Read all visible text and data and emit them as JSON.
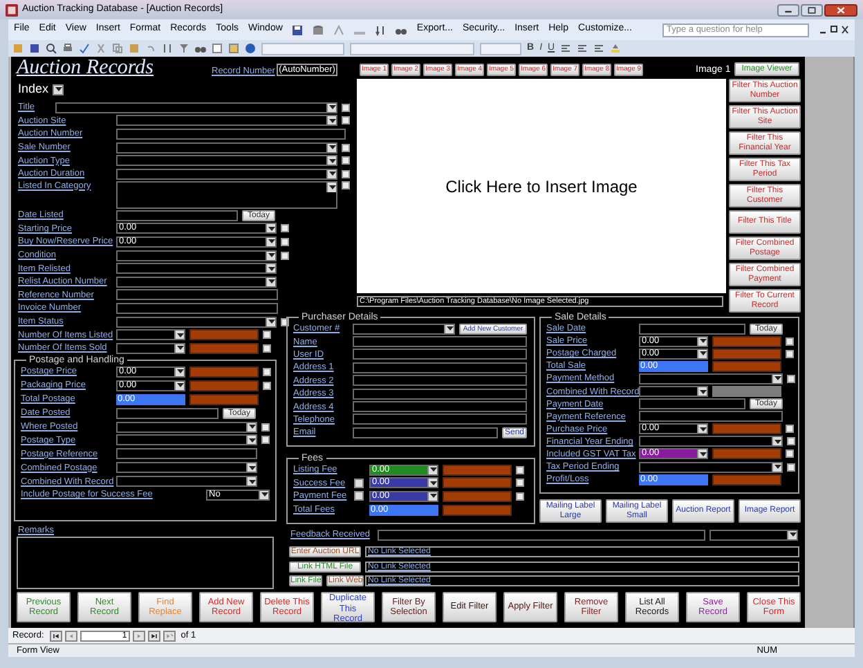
{
  "window": {
    "title": "Auction Tracking Database - [Auction Records]"
  },
  "menu": [
    "File",
    "Edit",
    "View",
    "Insert",
    "Format",
    "Records",
    "Tools",
    "Window"
  ],
  "menu_right": [
    "Export...",
    "Security...",
    "Insert",
    "Help",
    "Customize..."
  ],
  "help": {
    "placeholder": "Type a question for help"
  },
  "format_buttons": [
    "B",
    "I",
    "U"
  ],
  "form": {
    "heading": "Auction Records",
    "record_number": {
      "label": "Record Number",
      "value": "(AutoNumber)"
    },
    "image_tabs": [
      "Image 1",
      "Image 2",
      "Image 3",
      "Image 4",
      "Image 5",
      "Image 6",
      "Image 7",
      "Image 8",
      "Image 9"
    ],
    "image_label": "Image 1",
    "image_viewer": "Image Viewer",
    "image_prompt": "Click Here to Insert Image",
    "image_path": "C:\\Program Files\\Auction Tracking Database\\No Image Selected.jpg",
    "filters": [
      "Filter This Auction Number",
      "Filter This Auction Site",
      "Filter This Financial Year",
      "Filter This Tax Period",
      "Filter This Customer",
      "Filter This Title",
      "Filter Combined Postage",
      "Filter Combined Payment",
      "Filter To Current Record"
    ],
    "index": "Index",
    "fields": [
      {
        "label": "Title",
        "kind": "wide_combo_check"
      },
      {
        "label": "Auction Site",
        "kind": "combo_check"
      },
      {
        "label": "Auction Number",
        "kind": "text"
      },
      {
        "label": "Sale Number",
        "kind": "combo_check"
      },
      {
        "label": "Auction Type",
        "kind": "combo_check"
      },
      {
        "label": "Auction Duration",
        "kind": "combo_check"
      },
      {
        "label": "Listed In Category",
        "kind": "memo_check"
      }
    ],
    "fields_2": [
      {
        "label": "Date Listed",
        "kind": "date",
        "button": "Today"
      },
      {
        "label": "Starting Price",
        "kind": "combo_check",
        "value": "0.00"
      },
      {
        "label": "Buy Now/Reserve Price",
        "kind": "combo_check",
        "value": "0.00"
      },
      {
        "label": "Condition",
        "kind": "combo_check"
      },
      {
        "label": "Item Relisted",
        "kind": "combo"
      },
      {
        "label": "Relist Auction Number",
        "kind": "combo"
      },
      {
        "label": "Reference Number",
        "kind": "text"
      },
      {
        "label": "Invoice Number",
        "kind": "text"
      },
      {
        "label": "Item Status",
        "kind": "combo_check"
      },
      {
        "label": "Number Of Items Listed",
        "kind": "split_check"
      },
      {
        "label": "Number Of Items Sold",
        "kind": "split_check"
      }
    ],
    "postage": {
      "title": "Postage and Handling",
      "fields": [
        {
          "label": "Postage Price",
          "kind": "split_check",
          "value": "0.00"
        },
        {
          "label": "Packaging Price",
          "kind": "split_check",
          "value": "0.00"
        },
        {
          "label": "Total Postage",
          "kind": "calc",
          "value": "0.00"
        },
        {
          "label": "Date Posted",
          "kind": "date",
          "button": "Today"
        },
        {
          "label": "Where Posted",
          "kind": "combo_check"
        },
        {
          "label": "Postage Type",
          "kind": "combo_check"
        },
        {
          "label": "Postage Reference",
          "kind": "text"
        },
        {
          "label": "Combined Postage",
          "kind": "combo"
        },
        {
          "label": "Combined With Record",
          "kind": "combo"
        },
        {
          "label": "Include Postage for Success Fee",
          "kind": "small_combo",
          "value": "No"
        }
      ]
    },
    "remarks": "Remarks",
    "purchaser": {
      "title": "Purchaser Details",
      "fields": [
        {
          "label": "Customer #",
          "kind": "combo_button",
          "button": "Add New Customer"
        },
        {
          "label": "Name",
          "kind": "text"
        },
        {
          "label": "User ID",
          "kind": "text"
        },
        {
          "label": "Address 1",
          "kind": "text"
        },
        {
          "label": "Address 2",
          "kind": "text"
        },
        {
          "label": "Address 3",
          "kind": "text"
        },
        {
          "label": "Address 4",
          "kind": "text"
        },
        {
          "label": "Telephone",
          "kind": "text"
        },
        {
          "label": "Email",
          "kind": "text_button",
          "button": "Send"
        }
      ]
    },
    "fees": {
      "title": "Fees",
      "fields": [
        {
          "label": "Listing Fee",
          "kind": "split_check",
          "value": "0.00",
          "color": "#1e8c1e"
        },
        {
          "label": "Success Fee",
          "kind": "pre_split_check",
          "value": "0.00",
          "color": "#3a3aa6"
        },
        {
          "label": "Payment Fee",
          "kind": "pre_split_check",
          "value": "0.00",
          "color": "#3a3aa6"
        },
        {
          "label": "Total Fees",
          "kind": "calc",
          "value": "0.00"
        }
      ]
    },
    "sale": {
      "title": "Sale Details",
      "fields": [
        {
          "label": "Sale Date",
          "kind": "date",
          "button": "Today"
        },
        {
          "label": "Sale Price",
          "kind": "split_check",
          "value": "0.00"
        },
        {
          "label": "Postage Charged",
          "kind": "split_check",
          "value": "0.00"
        },
        {
          "label": "Total Sale",
          "kind": "calc",
          "value": "0.00"
        },
        {
          "label": "Payment Method",
          "kind": "combo_check"
        },
        {
          "label": "Combined With Record",
          "kind": "combo_gray"
        },
        {
          "label": "Payment Date",
          "kind": "date",
          "button": "Today"
        },
        {
          "label": "Payment Reference",
          "kind": "text"
        },
        {
          "label": "Purchase Price",
          "kind": "split_check",
          "value": "0.00"
        },
        {
          "label": "Financial Year Ending",
          "kind": "combo_check"
        },
        {
          "label": "Included GST VAT Tax",
          "kind": "split_check",
          "value": "0.00",
          "color": "#8a1a9e"
        },
        {
          "label": "Tax Period Ending",
          "kind": "combo_check"
        },
        {
          "label": "Profit/Loss",
          "kind": "calc",
          "value": "0.00"
        }
      ]
    },
    "reports": [
      "Mailing Label Large",
      "Mailing Label Small",
      "Auction Report",
      "Image Report"
    ],
    "feedback": "Feedback Received",
    "links": [
      {
        "buttons": [
          {
            "label": "Enter Auction URL",
            "color": "#a0502c"
          }
        ],
        "value": "No Link Selected"
      },
      {
        "buttons": [
          {
            "label": "Link HTML File",
            "color": "#2e8a2e"
          }
        ],
        "value": "No Link Selected"
      },
      {
        "buttons": [
          {
            "label": "Link File",
            "color": "#2e8a2e"
          },
          {
            "label": "Link Web",
            "color": "#a0502c"
          }
        ],
        "value": "No Link Selected"
      }
    ],
    "actions": [
      {
        "label": "Previous Record",
        "color": "#2e8b2e"
      },
      {
        "label": "Next Record",
        "color": "#2e8b2e"
      },
      {
        "label": "Find Replace",
        "color": "#f0822a"
      },
      {
        "label": "Add New Record",
        "color": "#e02424"
      },
      {
        "label": "Delete This Record",
        "color": "#e02424"
      },
      {
        "label": "Duplicate This Record",
        "color": "#2a40e0"
      },
      {
        "label": "Filter By Selection",
        "color": "#6e2020"
      },
      {
        "label": "Edit Filter",
        "color": "#3a1414"
      },
      {
        "label": "Apply Filter",
        "color": "#5e1212"
      },
      {
        "label": "Remove Filter",
        "color": "#8e1a1a"
      },
      {
        "label": "List All Records",
        "color": "#202020"
      },
      {
        "label": "Save Record",
        "color": "#9424a6"
      },
      {
        "label": "Close This Form",
        "color": "#e02424"
      }
    ]
  },
  "navigator": {
    "label": "Record:",
    "current": "1",
    "total": "of 1"
  },
  "status_bar": {
    "mode": "Form View",
    "indicator": "NUM"
  }
}
